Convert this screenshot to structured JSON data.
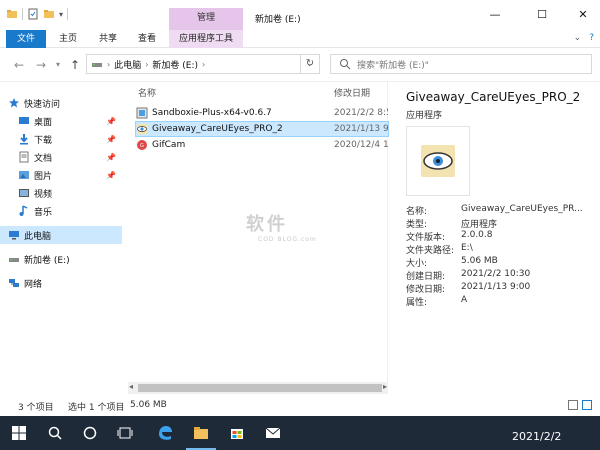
{
  "window": {
    "title": "新加卷 (E:)",
    "manage_tab": "管理"
  },
  "ribbon": {
    "tabs": [
      "文件",
      "主页",
      "共享",
      "查看",
      "应用程序工具"
    ]
  },
  "address": {
    "crumbs": [
      "此电脑",
      "新加卷 (E:)"
    ],
    "search_placeholder": "搜索\"新加卷 (E:)\""
  },
  "nav": {
    "items": [
      {
        "label": "快速访问",
        "icon": "star-icon"
      },
      {
        "label": "桌面",
        "icon": "desktop-icon"
      },
      {
        "label": "下载",
        "icon": "download-icon"
      },
      {
        "label": "文档",
        "icon": "document-icon"
      },
      {
        "label": "图片",
        "icon": "picture-icon"
      },
      {
        "label": "视频",
        "icon": "video-icon"
      },
      {
        "label": "音乐",
        "icon": "music-icon"
      },
      {
        "label": "此电脑",
        "icon": "computer-icon"
      },
      {
        "label": "新加卷 (E:)",
        "icon": "drive-icon"
      },
      {
        "label": "网络",
        "icon": "network-icon"
      }
    ]
  },
  "list": {
    "col_name": "名称",
    "col_date": "修改日期",
    "files": [
      {
        "name": "Sandboxie-Plus-x64-v0.6.7",
        "date": "2021/2/2 8:5"
      },
      {
        "name": "Giveaway_CareUEyes_PRO_2",
        "date": "2021/1/13 9"
      },
      {
        "name": "GifCam",
        "date": "2020/12/4 1"
      }
    ]
  },
  "preview": {
    "title": "Giveaway_CareUEyes_PRO_2",
    "subtitle": "应用程序",
    "props": [
      {
        "k": "名称:",
        "v": "Giveaway_CareUEyes_PR..."
      },
      {
        "k": "类型:",
        "v": "应用程序"
      },
      {
        "k": "文件版本:",
        "v": "2.0.0.8"
      },
      {
        "k": "文件夹路径:",
        "v": "E:\\"
      },
      {
        "k": "大小:",
        "v": "5.06 MB"
      },
      {
        "k": "创建日期:",
        "v": "2021/2/2 10:30"
      },
      {
        "k": "修改日期:",
        "v": "2021/1/13 9:00"
      },
      {
        "k": "属性:",
        "v": "A"
      }
    ]
  },
  "status": {
    "count": "3 个项目",
    "selected": "选中 1 个项目",
    "size": "5.06 MB"
  },
  "taskbar": {
    "date": "2021/2/2"
  },
  "watermark": {
    "text": "软件",
    "sub": "COD BLOG.com"
  }
}
